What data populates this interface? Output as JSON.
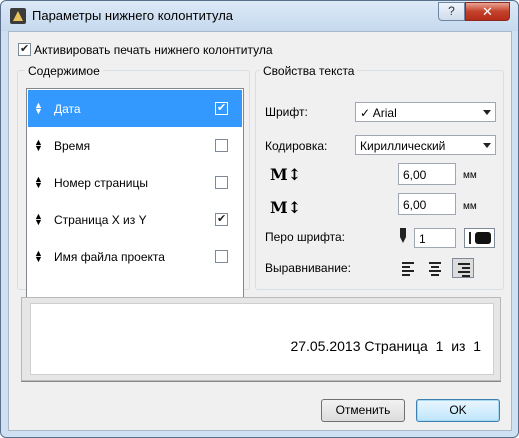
{
  "window": {
    "title": "Параметры нижнего колонтитула",
    "help_label": "?",
    "close_label": "✕"
  },
  "activate": {
    "label": "Активировать печать нижнего колонтитула",
    "checked": true
  },
  "content_group": {
    "title": "Содержимое",
    "items": [
      {
        "label": "Дата",
        "checked": true,
        "selected": true
      },
      {
        "label": "Время",
        "checked": false,
        "selected": false
      },
      {
        "label": "Номер страницы",
        "checked": false,
        "selected": false
      },
      {
        "label": "Страница X из Y",
        "checked": true,
        "selected": false
      },
      {
        "label": "Имя файла проекта",
        "checked": false,
        "selected": false
      }
    ]
  },
  "text_props": {
    "title": "Свойства текста",
    "font_label": "Шрифт:",
    "font_value": "✓ Arial",
    "encoding_label": "Кодировка:",
    "encoding_value": "Кириллический",
    "size1_icon": "M↕",
    "size1_value": "6,00",
    "size1_unit": "мм",
    "size2_icon": "M↕",
    "size2_value": "6,00",
    "size2_unit": "мм",
    "pen_label": "Перо шрифта:",
    "pen_value": "1",
    "align_label": "Выравнивание:",
    "align_active": "right"
  },
  "preview": {
    "text": "27.05.2013 Страница  1  из  1"
  },
  "buttons": {
    "cancel": "Отменить",
    "ok": "OK"
  },
  "colors": {
    "selection": "#3399ff",
    "ok_border": "#3c7fb1"
  }
}
